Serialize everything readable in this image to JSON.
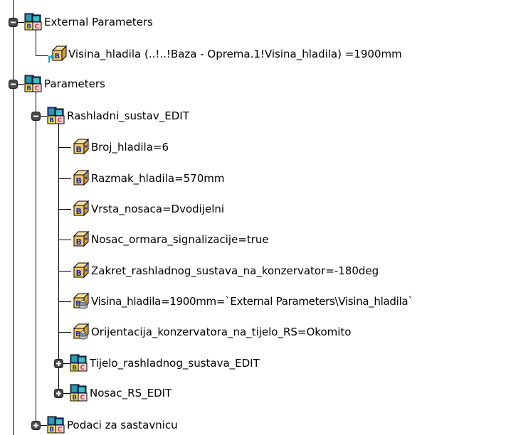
{
  "tree": {
    "external_parameters": {
      "label": "External Parameters",
      "children": [
        {
          "label": "Visina_hladila (..!..!Baza - Oprema.1!Visina_hladila) =1900mm"
        }
      ]
    },
    "parameters": {
      "label": "Parameters",
      "rashladni": {
        "label": "Rashladni_sustav_EDIT",
        "items": [
          {
            "label": "Broj_hladila=6"
          },
          {
            "label": "Razmak_hladila=570mm"
          },
          {
            "label": "Vrsta_nosaca=Dvodijelni"
          },
          {
            "label": "Nosac_ormara_signalizacije=true"
          },
          {
            "label": "Zakret_rashladnog_sustava_na_konzervator=-180deg"
          },
          {
            "label": "Visina_hladila=1900mm=`External Parameters\\Visina_hladila`"
          },
          {
            "label": "Orijentacija_konzervatora_na_tijelo_RS=Okomito"
          }
        ]
      },
      "tijelo": {
        "label": "Tijelo_rashladnog_sustava_EDIT"
      },
      "nosac": {
        "label": "Nosac_RS_EDIT"
      }
    },
    "podaci": {
      "label": "Podaci za sastavnicu"
    }
  },
  "icons": {
    "set": "parameter-set-icon",
    "param": "parameter-icon",
    "formula": "formula-parameter-icon",
    "external": "external-parameter-icon",
    "expanded": "minus-expander-icon",
    "collapsed": "plus-expander-icon"
  },
  "colors": {
    "cube_face": "#f0c66a",
    "cube_top": "#f7df9e",
    "cube_side": "#d6a23a",
    "letter_blue": "#1f2fb0",
    "set_blue": "#2d5da8",
    "set_teal": "#27a0a0",
    "set_yellow": "#f5e04a",
    "set_red": "#d23a3a"
  }
}
